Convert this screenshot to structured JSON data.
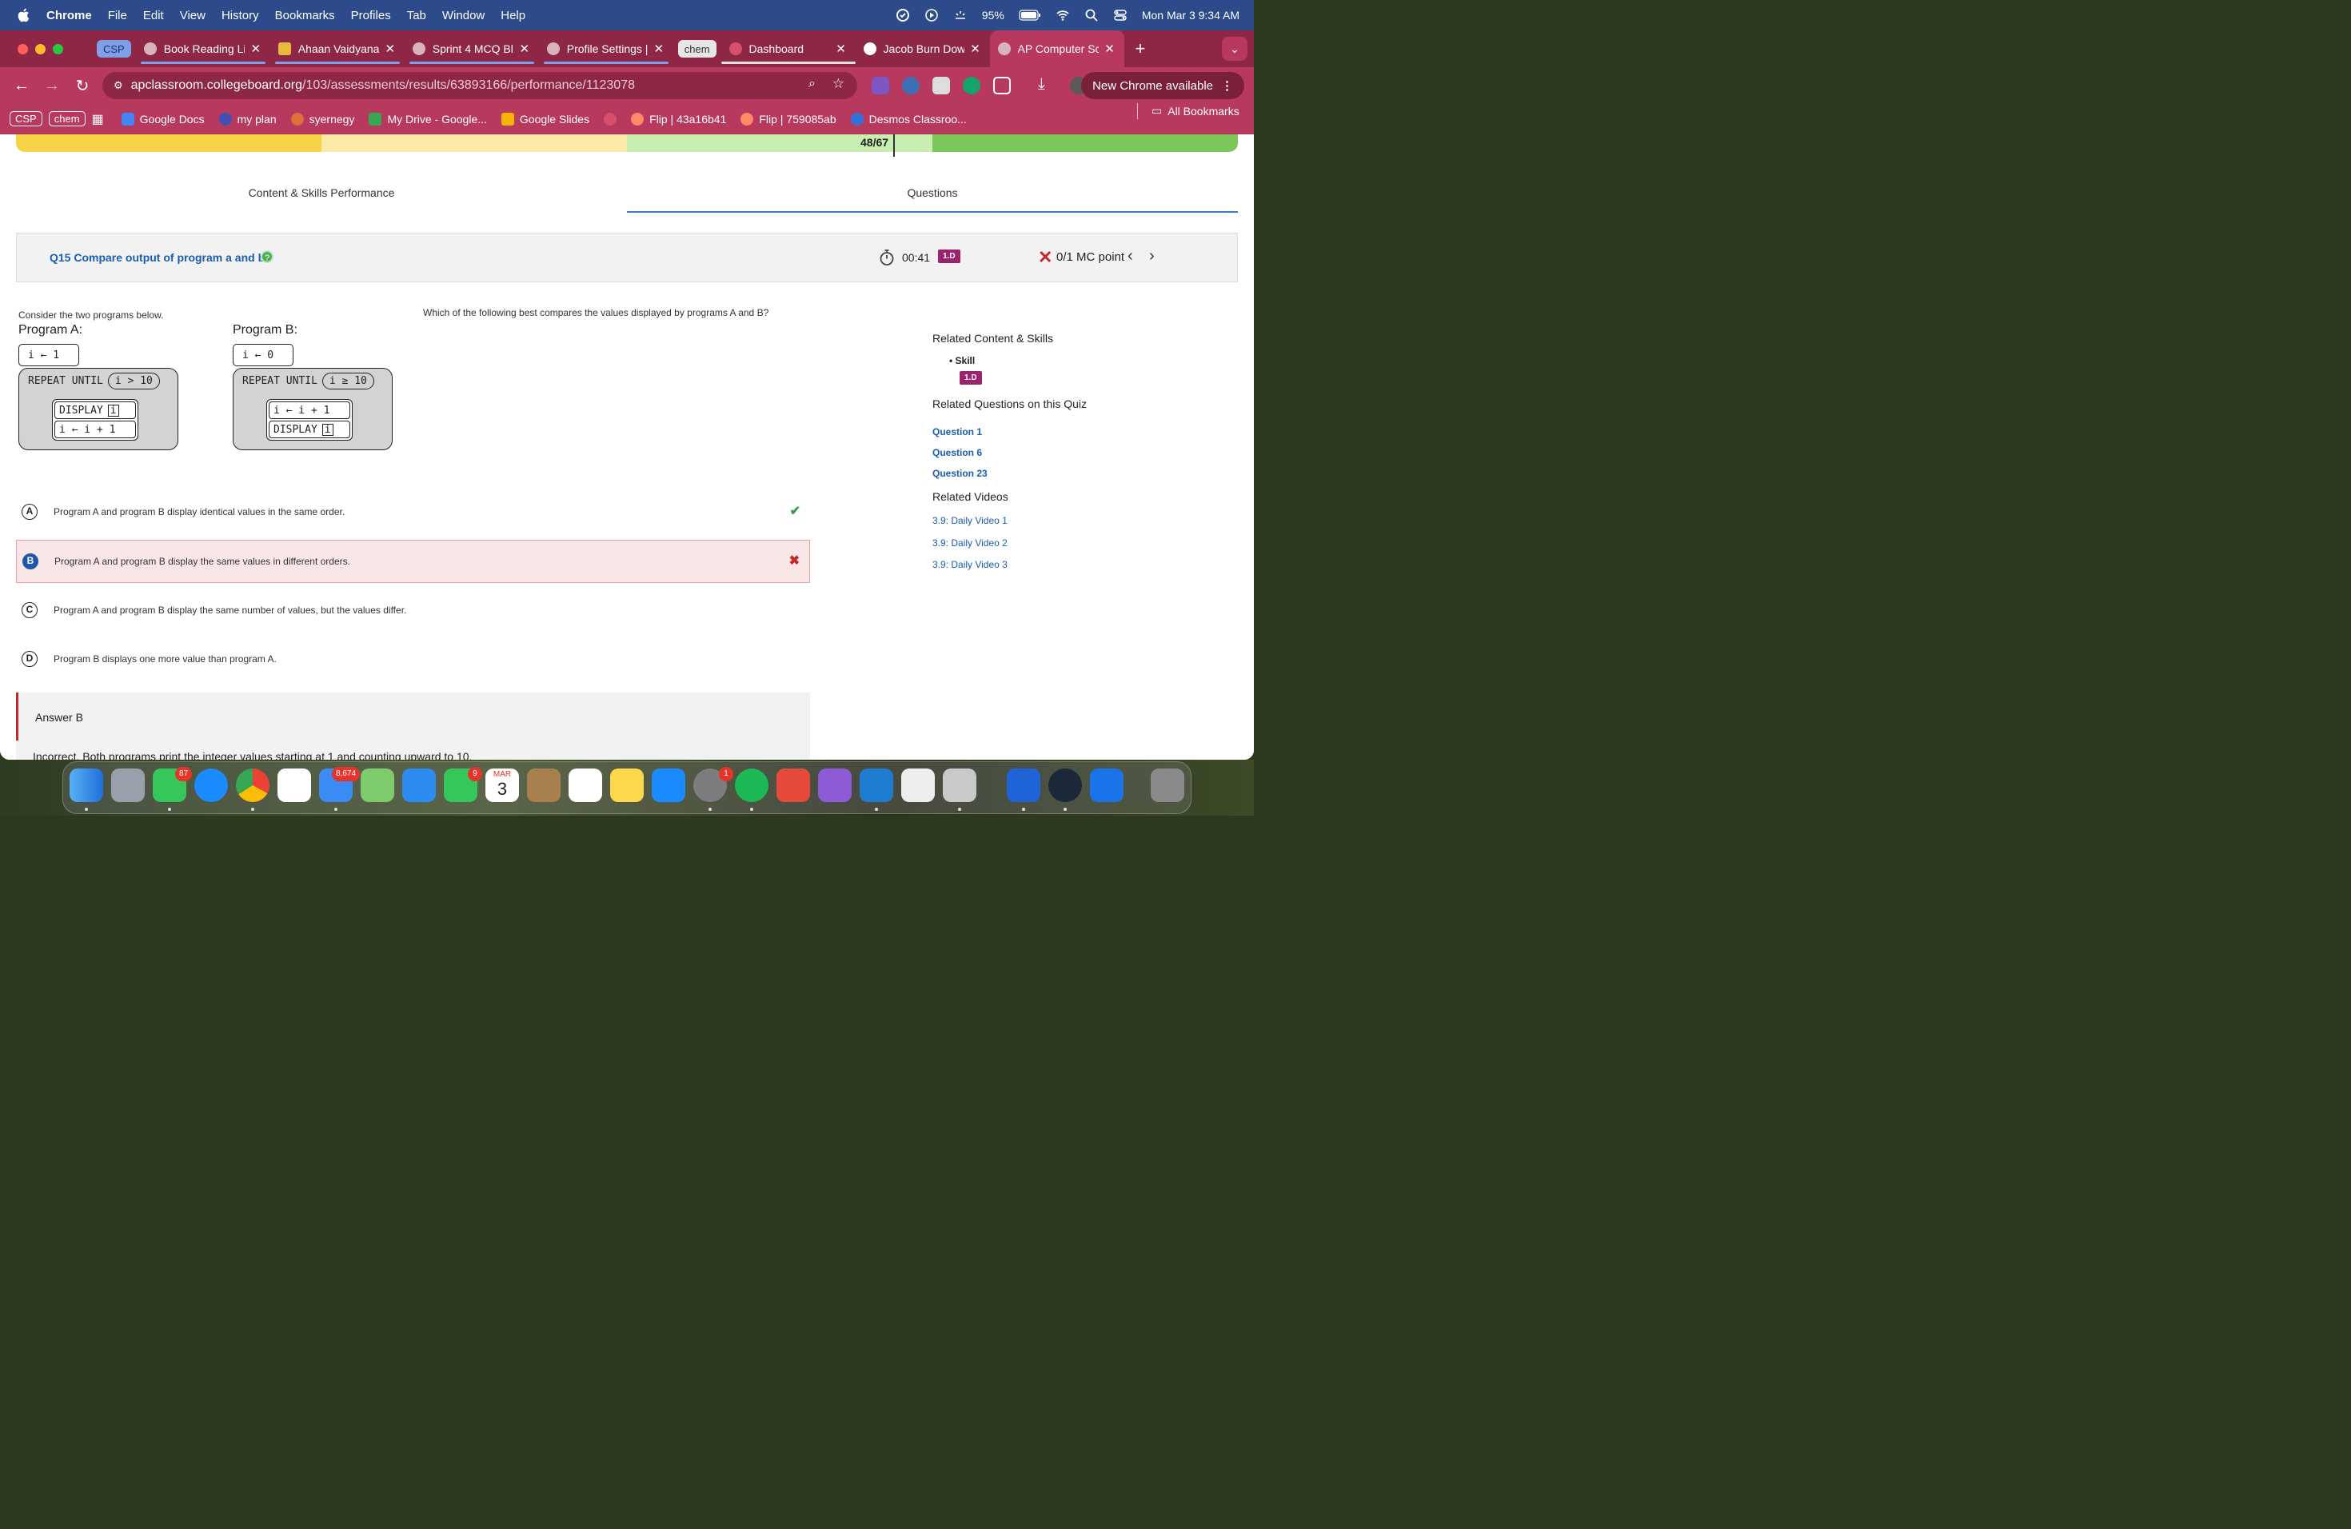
{
  "menubar": {
    "app": "Chrome",
    "items": [
      "File",
      "Edit",
      "View",
      "History",
      "Bookmarks",
      "Profiles",
      "Tab",
      "Window",
      "Help"
    ],
    "battery": "95%",
    "datetime": "Mon Mar 3  9:34 AM"
  },
  "tabs": {
    "group_csp": "CSP",
    "group_chem": "chem",
    "items": [
      {
        "title": "Book Reading Lis"
      },
      {
        "title": "Ahaan Vaidyanat"
      },
      {
        "title": "Sprint 4 MCQ Bl"
      },
      {
        "title": "Profile Settings |"
      },
      {
        "title": "Dashboard"
      },
      {
        "title": "Jacob Burn Dow"
      },
      {
        "title": "AP Computer Sc"
      }
    ],
    "new_tab": "+"
  },
  "toolbar": {
    "url_host": "apclassroom.collegeboard.org",
    "url_path": "/103/assessments/results/63893166/performance/1123078",
    "new_chrome": "New Chrome available"
  },
  "bookmarks": {
    "chip_csp": "CSP",
    "chip_chem": "chem",
    "items": [
      "Google Docs",
      "my plan",
      "syernegy",
      "My Drive - Google...",
      "Google Slides",
      "Flip | 43a16b41",
      "Flip | 759085ab",
      "Desmos Classroo..."
    ],
    "all": "All Bookmarks"
  },
  "progress": {
    "label": "48/67",
    "value": 48,
    "total": 67,
    "colors": [
      "#f5d547",
      "#fbeaa6",
      "#c9efb0",
      "#7dc65a"
    ]
  },
  "page_tabs": {
    "content": "Content & Skills Performance",
    "questions": "Questions"
  },
  "question": {
    "title": "Q15 Compare output of program a and b",
    "help": "?",
    "time": "00:41",
    "skill": "1.D",
    "score": "0/1 MC point",
    "intro": "Consider the two programs below.",
    "prompt": "Which of the following best compares the values displayed by programs A and B?",
    "program_a": {
      "label": "Program A:",
      "assign": "i ← 1",
      "repeat": "REPEAT UNTIL",
      "cond": "i > 10",
      "display": "DISPLAY",
      "display_var": "i",
      "increment": "i ← i + 1"
    },
    "program_b": {
      "label": "Program B:",
      "assign": "i ← 0",
      "repeat": "REPEAT UNTIL",
      "cond": "i ≥ 10",
      "increment": "i ← i + 1",
      "display": "DISPLAY",
      "display_var": "i"
    },
    "choices": [
      {
        "letter": "A",
        "text": "Program A and program B display identical values in the same order.",
        "mark": "✔"
      },
      {
        "letter": "B",
        "text": "Program A and program B display the same values in different orders.",
        "mark": "✖"
      },
      {
        "letter": "C",
        "text": "Program A and program B display the same number of values, but the values differ."
      },
      {
        "letter": "D",
        "text": "Program B displays one more value than program A."
      }
    ],
    "answer_title": "Answer B",
    "answer_expl": "Incorrect. Both programs print the integer values starting at  1  and counting upward to  10."
  },
  "related": {
    "content_h": "Related Content & Skills",
    "skill_label": "Skill",
    "skill_badge": "1.D",
    "questions_h": "Related Questions on this Quiz",
    "questions": [
      "Question 1",
      "Question 6",
      "Question 23"
    ],
    "videos_h": "Related Videos",
    "videos": [
      "3.9: Daily Video 1",
      "3.9: Daily Video 2",
      "3.9: Daily Video 3"
    ]
  },
  "dock": {
    "badges": {
      "messages": "87",
      "mail": "8,674",
      "facetime": "9",
      "settings": "1"
    },
    "calendar_month": "MAR",
    "calendar_day": "3"
  }
}
